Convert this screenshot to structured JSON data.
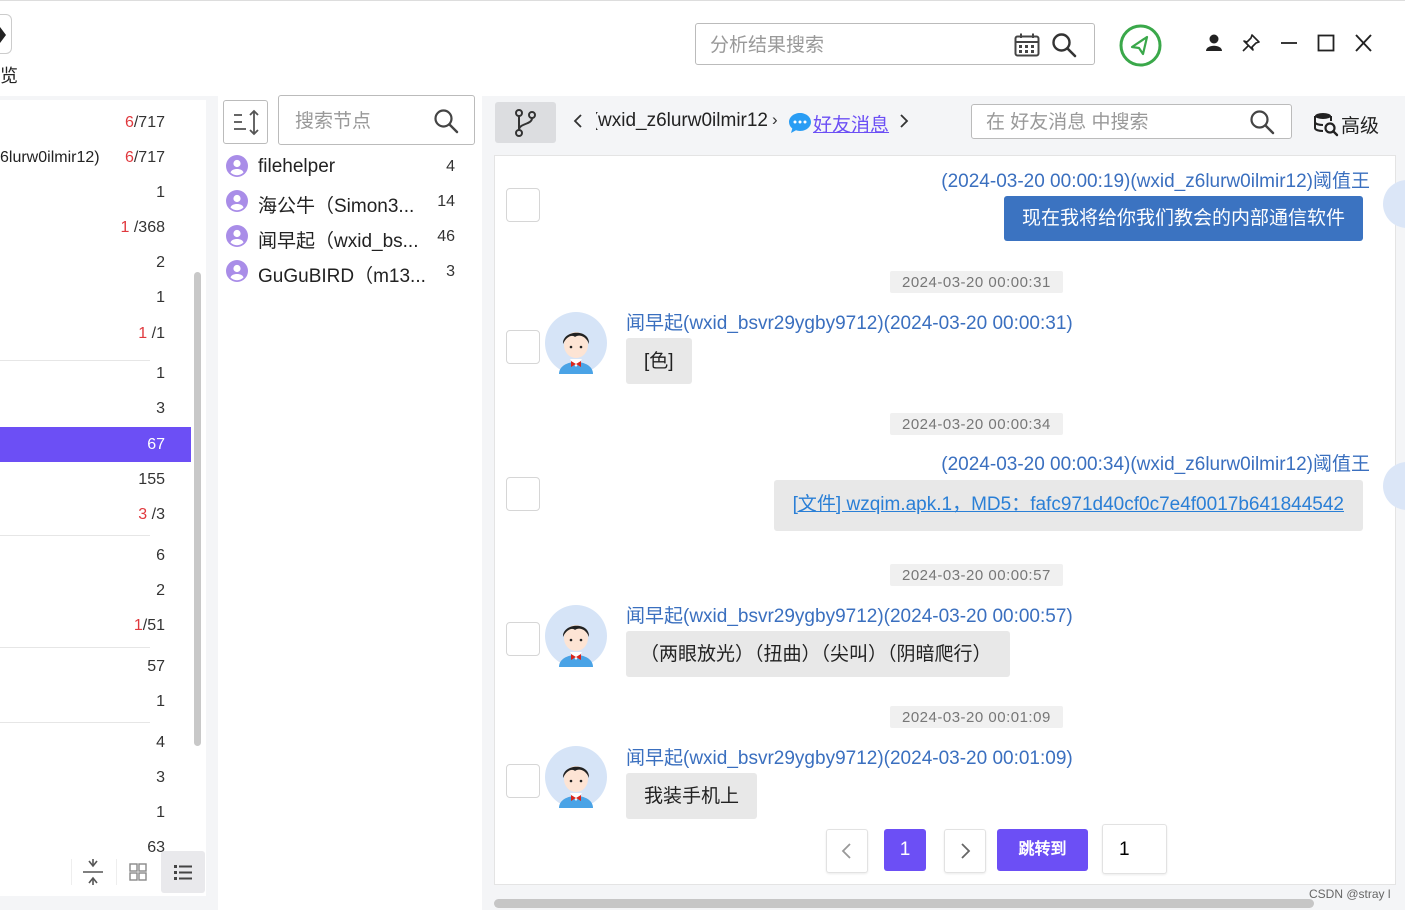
{
  "window": {
    "preview_label": "预览",
    "search": {
      "placeholder": "分析结果搜索"
    }
  },
  "tree": {
    "rows": [
      {
        "label": "",
        "count_red": "6",
        "count": "/717"
      },
      {
        "label": "6lurw0ilmir12)",
        "count_red": "6",
        "count": "/717"
      },
      {
        "label": "",
        "count_red": "",
        "count": "1"
      },
      {
        "label": "",
        "count_red": "1",
        "count": " /368"
      },
      {
        "label": "",
        "count_red": "",
        "count": "2"
      },
      {
        "label": "",
        "count_red": "",
        "count": "1"
      },
      {
        "label": "",
        "count_red": "1",
        "count": " /1"
      },
      {
        "label": "",
        "count_red": "",
        "count": "1"
      },
      {
        "label": "",
        "count_red": "",
        "count": "3"
      },
      {
        "label": "",
        "count_red": "",
        "count": "67"
      },
      {
        "label": "",
        "count_red": "",
        "count": "155"
      },
      {
        "label": "",
        "count_red": "3",
        "count": " /3"
      },
      {
        "label": "",
        "count_red": "",
        "count": "6"
      },
      {
        "label": "",
        "count_red": "",
        "count": "2"
      },
      {
        "label": "",
        "count_red": "1",
        "count": "/51"
      },
      {
        "label": "",
        "count_red": "",
        "count": "57"
      },
      {
        "label": "",
        "count_red": "",
        "count": "1"
      },
      {
        "label": "",
        "count_red": "",
        "count": "4"
      },
      {
        "label": "",
        "count_red": "",
        "count": "3"
      },
      {
        "label": "",
        "count_red": "",
        "count": "1"
      },
      {
        "label": "",
        "count_red": "",
        "count": "63"
      }
    ],
    "selected_index": 9
  },
  "nodes": {
    "search_placeholder": "搜索节点",
    "items": [
      {
        "name": "filehelper",
        "count": "4"
      },
      {
        "name": "海公牛（Simon3...",
        "count": "14"
      },
      {
        "name": "闻早起（wxid_bs...",
        "count": "46"
      },
      {
        "name": "GuGuBIRD（m13...",
        "count": "3"
      }
    ]
  },
  "chat": {
    "breadcrumb_parent": "wxid_z6lurw0ilmir12)",
    "breadcrumb_current": "好友消息",
    "search_placeholder": "在 好友消息 中搜索",
    "advanced_label": "高级",
    "messages": [
      {
        "sender": "(2024-03-20 00:00:19)(wxid_z6lurw0ilmir12)阈值王",
        "text": "现在我将给你我们教会的内部通信软件"
      },
      {
        "timestamp": "2024-03-20 00:00:31",
        "sender": "闻早起(wxid_bsvr29ygby9712)(2024-03-20 00:00:31)",
        "text": "[色]"
      },
      {
        "timestamp": "2024-03-20 00:00:34",
        "sender": "(2024-03-20 00:00:34)(wxid_z6lurw0ilmir12)阈值王",
        "text": "[文件] wzqim.apk.1，MD5：fafc971d40cf0c7e4f0017b641844542"
      },
      {
        "timestamp": "2024-03-20 00:00:57",
        "sender": "闻早起(wxid_bsvr29ygby9712)(2024-03-20 00:00:57)",
        "text": "（两眼放光）（扭曲）（尖叫）（阴暗爬行）"
      },
      {
        "timestamp": "2024-03-20 00:01:09",
        "sender": "闻早起(wxid_bsvr29ygby9712)(2024-03-20 00:01:09)",
        "text": "我装手机上"
      }
    ]
  },
  "pagination": {
    "current": "1",
    "jump_label": "跳转到",
    "jump_value": "1"
  },
  "watermark": "CSDN @stray l",
  "colors": {
    "accent": "#6c4ff5",
    "sender_blue": "#3a6fbf",
    "bubble_blue": "#3b73c1",
    "link_blue": "#2a7fd6",
    "count_red": "#e0393e",
    "shield_green": "#3aa84a"
  }
}
